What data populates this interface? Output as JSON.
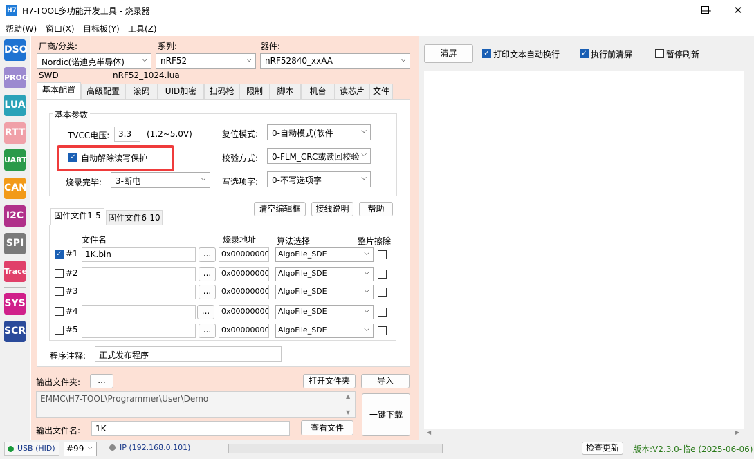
{
  "window": {
    "icon_text": "H7",
    "title": "H7-TOOL多功能开发工具 - 烧录器"
  },
  "menu": [
    "帮助(W)",
    "窗口(X)",
    "目标板(Y)",
    "工具(Z)"
  ],
  "sidebar": [
    {
      "label": "DSO",
      "color": "#1e73d2"
    },
    {
      "label": "PROG",
      "color": "#9c8ad0"
    },
    {
      "label": "LUA",
      "color": "#2aa2b8"
    },
    {
      "label": "RTT",
      "color": "#f0a0a8"
    },
    {
      "label": "UART",
      "color": "#2a9a4a"
    },
    {
      "label": "CAN",
      "color": "#f29a18"
    },
    {
      "label": "I2C",
      "color": "#b0308a"
    },
    {
      "label": "SPI",
      "color": "#7a7a7a"
    },
    {
      "label": "Trace",
      "color": "#e0406a"
    },
    {
      "label": "SYS",
      "color": "#d0208a"
    },
    {
      "label": "SCR",
      "color": "#2a4a9a"
    }
  ],
  "device": {
    "vendor_label": "厂商/分类:",
    "vendor_value": "Nordic(诺迪克半导体)",
    "series_label": "系列:",
    "series_value": "nRF52",
    "part_label": "器件:",
    "part_value": "nRF52840_xxAA",
    "interface": "SWD",
    "lua_file": "nRF52_1024.lua"
  },
  "tabs": [
    "基本配置",
    "高级配置",
    "滚码",
    "UID加密",
    "扫码枪",
    "限制",
    "脚本",
    "机台",
    "读芯片",
    "文件"
  ],
  "basic": {
    "group_title": "基本参数",
    "tvcc_label": "TVCC电压:",
    "tvcc_value": "3.3",
    "tvcc_range": "(1.2~5.0V)",
    "auto_unlock_label": "自动解除读写保护",
    "finish_label": "烧录完毕:",
    "finish_value": "3-断电",
    "reset_label": "复位模式:",
    "reset_value": "0-自动模式(软件",
    "verify_label": "校验方式:",
    "verify_value": "0-FLM_CRC或读回校验",
    "option_label": "写选项字:",
    "option_value": "0-不写选项字"
  },
  "buttons": {
    "clear_editor": "清空编辑框",
    "wiring": "接线说明",
    "help": "帮助",
    "browse": "...",
    "open_folder": "打开文件夹",
    "import": "导入",
    "download": "一键下载",
    "view_file": "查看文件",
    "clear_screen": "清屏",
    "check_update": "检查更新"
  },
  "file_tabs": [
    "固件文件1-5",
    "固件文件6-10"
  ],
  "file_table": {
    "headers": {
      "name": "文件名",
      "addr": "烧录地址",
      "algo": "算法选择",
      "erase": "整片擦除"
    },
    "rows": [
      {
        "checked": true,
        "id": "#1",
        "file": "1K.bin",
        "addr": "0x00000000",
        "algo": "AlgoFile_SDE"
      },
      {
        "checked": false,
        "id": "#2",
        "file": "",
        "addr": "0x00000000",
        "algo": "AlgoFile_SDE"
      },
      {
        "checked": false,
        "id": "#3",
        "file": "",
        "addr": "0x00000000",
        "algo": "AlgoFile_SDE"
      },
      {
        "checked": false,
        "id": "#4",
        "file": "",
        "addr": "0x00000000",
        "algo": "AlgoFile_SDE"
      },
      {
        "checked": false,
        "id": "#5",
        "file": "",
        "addr": "0x00000000",
        "algo": "AlgoFile_SDE"
      }
    ]
  },
  "comment": {
    "label": "程序注释:",
    "value": "正式发布程序"
  },
  "output": {
    "folder_label": "输出文件夹:",
    "path": "EMMC\\H7-TOOL\\Programmer\\User\\Demo",
    "name_label": "输出文件名:",
    "name_value": "1K"
  },
  "right": {
    "wrap_label": "打印文本自动换行",
    "clear_before_label": "执行前清屏",
    "pause_label": "暂停刷新"
  },
  "status": {
    "usb": "USB (HID)",
    "port": "#99",
    "ip": "IP (192.168.0.101)",
    "version": "版本:V2.3.0-临e (2025-06-06)"
  }
}
